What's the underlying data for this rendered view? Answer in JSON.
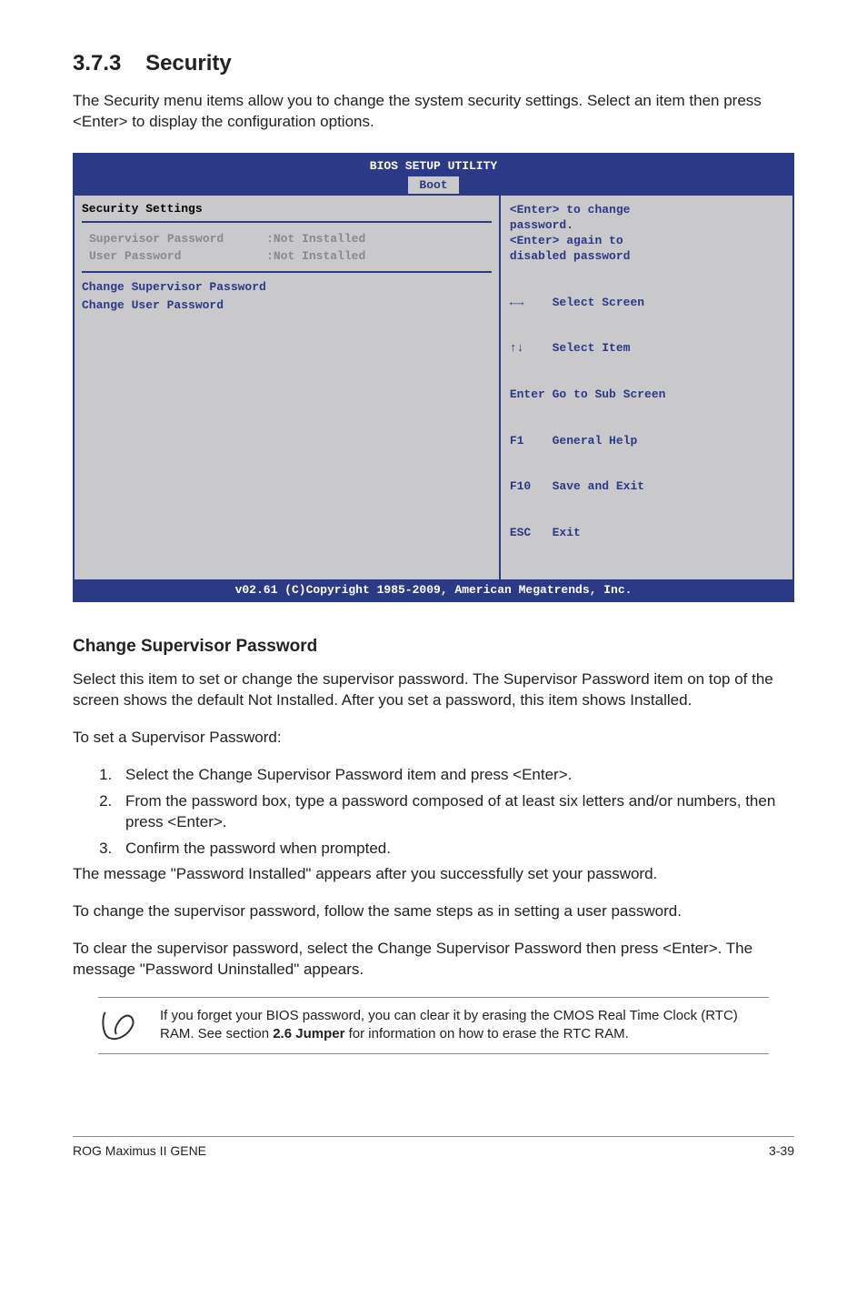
{
  "section": {
    "number": "3.7.3",
    "title": "Security"
  },
  "intro": "The Security menu items allow you to change the system security settings. Select an item then press <Enter> to display the configuration options.",
  "bios": {
    "title": "BIOS SETUP UTILITY",
    "tab": "Boot",
    "section_heading": "Security Settings",
    "rows": [
      {
        "label": "Supervisor Password",
        "value": ":Not Installed"
      },
      {
        "label": "User Password",
        "value": ":Not Installed"
      }
    ],
    "links": [
      "Change Supervisor Password",
      "Change User Password"
    ],
    "help_top": [
      "<Enter> to change",
      "password.",
      "<Enter> again to",
      "disabled password"
    ],
    "keys": [
      "←→    Select Screen",
      "↑↓    Select Item",
      "Enter Go to Sub Screen",
      "F1    General Help",
      "F10   Save and Exit",
      "ESC   Exit"
    ],
    "footer": "v02.61 (C)Copyright 1985-2009, American Megatrends, Inc."
  },
  "subheading": "Change Supervisor Password",
  "para1": "Select this item to set or change the supervisor password. The Supervisor Password item on top of the screen shows the default Not Installed. After you set a password, this item shows Installed.",
  "para2": "To set a Supervisor Password:",
  "list": [
    "Select the Change Supervisor Password item and press <Enter>.",
    "From the password box, type a password composed of at least six letters and/or numbers, then press <Enter>.",
    "Confirm the password when prompted."
  ],
  "after_list": "The message \"Password Installed\" appears after you successfully set your password.",
  "para3": "To change the supervisor password, follow the same steps as in setting a user password.",
  "para4": "To clear the supervisor password, select the Change Supervisor Password then press <Enter>. The message \"Password Uninstalled\" appears.",
  "note": {
    "text_before": "If you forget your BIOS password, you can clear it by erasing the CMOS Real Time Clock (RTC) RAM. See section ",
    "bold": "2.6 Jumper",
    "text_after": " for information on how to erase the RTC RAM."
  },
  "footer": {
    "left": "ROG Maximus II GENE",
    "right": "3-39"
  }
}
